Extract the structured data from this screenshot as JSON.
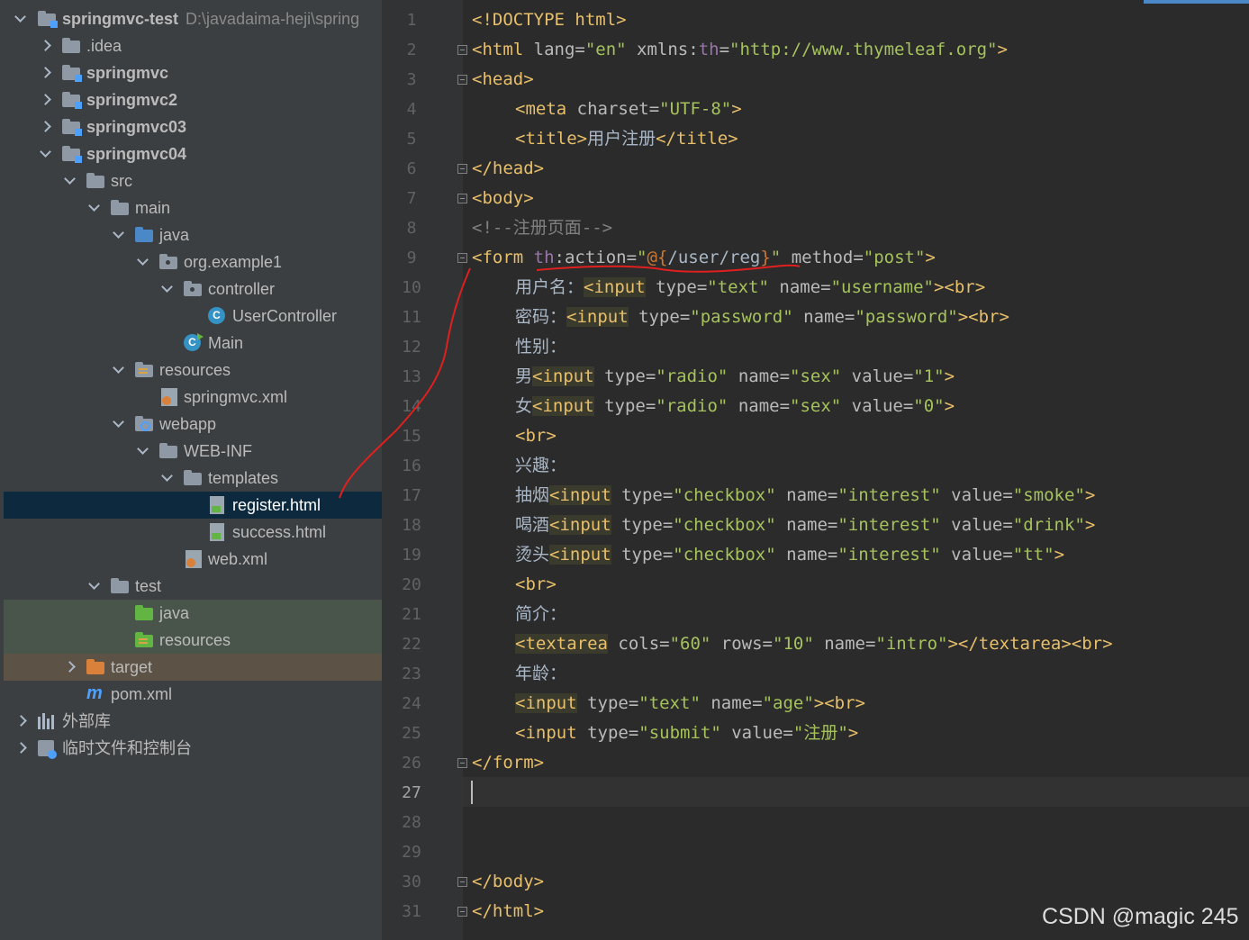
{
  "project_tree": {
    "root": {
      "name": "springmvc-test",
      "path": "D:\\javadaima-heji\\spring"
    },
    "items": [
      {
        "label": ".idea"
      },
      {
        "label": "springmvc"
      },
      {
        "label": "springmvc2"
      },
      {
        "label": "springmvc03"
      },
      {
        "label": "springmvc04"
      },
      {
        "label": "src"
      },
      {
        "label": "main"
      },
      {
        "label": "java"
      },
      {
        "label": "org.example1"
      },
      {
        "label": "controller"
      },
      {
        "label": "UserController"
      },
      {
        "label": "Main"
      },
      {
        "label": "resources"
      },
      {
        "label": "springmvc.xml"
      },
      {
        "label": "webapp"
      },
      {
        "label": "WEB-INF"
      },
      {
        "label": "templates"
      },
      {
        "label": "register.html"
      },
      {
        "label": "success.html"
      },
      {
        "label": "web.xml"
      },
      {
        "label": "test"
      },
      {
        "label": "java"
      },
      {
        "label": "resources"
      },
      {
        "label": "target"
      },
      {
        "label": "pom.xml"
      },
      {
        "label": "外部库"
      },
      {
        "label": "临时文件和控制台"
      }
    ],
    "icons": {
      "class_letter": "C",
      "maven_letter": "m"
    }
  },
  "editor": {
    "line_numbers": [
      "1",
      "2",
      "3",
      "4",
      "5",
      "6",
      "7",
      "8",
      "9",
      "10",
      "11",
      "12",
      "13",
      "14",
      "15",
      "16",
      "17",
      "18",
      "19",
      "20",
      "21",
      "22",
      "23",
      "24",
      "25",
      "26",
      "27",
      "28",
      "29",
      "30",
      "31"
    ],
    "current_line": "27",
    "lines": {
      "l1": {
        "a": "<!DOCTYPE html>"
      },
      "l2": {
        "a": "<html",
        "b": " lang=",
        "c": "\"en\"",
        "d": " xmlns:",
        "e": "th",
        "f": "=",
        "g": "\"http://www.thymeleaf.org\"",
        "h": ">"
      },
      "l3": {
        "a": "<head>"
      },
      "l4": {
        "a": "<meta",
        "b": " charset=",
        "c": "\"UTF-8\"",
        "d": ">"
      },
      "l5": {
        "a": "<title>",
        "b": "用户注册",
        "c": "</title>"
      },
      "l6": {
        "a": "</head>"
      },
      "l7": {
        "a": "<body>"
      },
      "l8": {
        "a": "<!--注册页面-->"
      },
      "l9": {
        "a": "<form",
        "b": " th",
        "c": ":action=",
        "d": "\"",
        "e": "@{",
        "f": "/user/reg",
        "g": "}",
        "h": "\"",
        "i": " method=",
        "j": "\"post\"",
        "k": ">"
      },
      "l10": {
        "a": "用户名：",
        "b": "<input",
        "c": " type=",
        "d": "\"text\"",
        "e": " name=",
        "f": "\"username\"",
        "g": "><br>"
      },
      "l11": {
        "a": "密码：",
        "b": "<input",
        "c": " type=",
        "d": "\"password\"",
        "e": " name=",
        "f": "\"password\"",
        "g": "><br>"
      },
      "l12": {
        "a": "性别："
      },
      "l13": {
        "a": "男",
        "b": "<input",
        "c": " type=",
        "d": "\"radio\"",
        "e": " name=",
        "f": "\"sex\"",
        "g": " value=",
        "h": "\"1\"",
        "i": ">"
      },
      "l14": {
        "a": "女",
        "b": "<input",
        "c": " type=",
        "d": "\"radio\"",
        "e": " name=",
        "f": "\"sex\"",
        "g": " value=",
        "h": "\"0\"",
        "i": ">"
      },
      "l15": {
        "a": "<br>"
      },
      "l16": {
        "a": "兴趣："
      },
      "l17": {
        "a": "抽烟",
        "b": "<input",
        "c": " type=",
        "d": "\"checkbox\"",
        "e": " name=",
        "f": "\"interest\"",
        "g": " value=",
        "h": "\"smoke\"",
        "i": ">"
      },
      "l18": {
        "a": "喝酒",
        "b": "<input",
        "c": " type=",
        "d": "\"checkbox\"",
        "e": " name=",
        "f": "\"interest\"",
        "g": " value=",
        "h": "\"drink\"",
        "i": ">"
      },
      "l19": {
        "a": "烫头",
        "b": "<input",
        "c": " type=",
        "d": "\"checkbox\"",
        "e": " name=",
        "f": "\"interest\"",
        "g": " value=",
        "h": "\"tt\"",
        "i": ">"
      },
      "l20": {
        "a": "<br>"
      },
      "l21": {
        "a": "简介："
      },
      "l22": {
        "a": "<textarea",
        "b": " cols=",
        "c": "\"60\"",
        "d": " rows=",
        "e": "\"10\"",
        "f": " name=",
        "g": "\"intro\"",
        "h": "></textarea><br>"
      },
      "l23": {
        "a": "年龄："
      },
      "l24": {
        "a": "<input",
        "b": " type=",
        "c": "\"text\"",
        "d": " name=",
        "e": "\"age\"",
        "f": "><br>"
      },
      "l25": {
        "a": "<input",
        "b": " type=",
        "c": "\"submit\"",
        "d": " value=",
        "e": "\"注册\"",
        "f": ">"
      },
      "l26": {
        "a": "</form>"
      },
      "l30": {
        "a": "</body>"
      },
      "l31": {
        "a": "</html>"
      }
    }
  },
  "colors": {
    "tag": "#e8bf6a",
    "attribute": "#bababa",
    "string": "#a5c25c",
    "namespace": "#9876aa",
    "comment": "#808080",
    "annotation": "#e0201f"
  },
  "watermark": "CSDN @magic 245"
}
